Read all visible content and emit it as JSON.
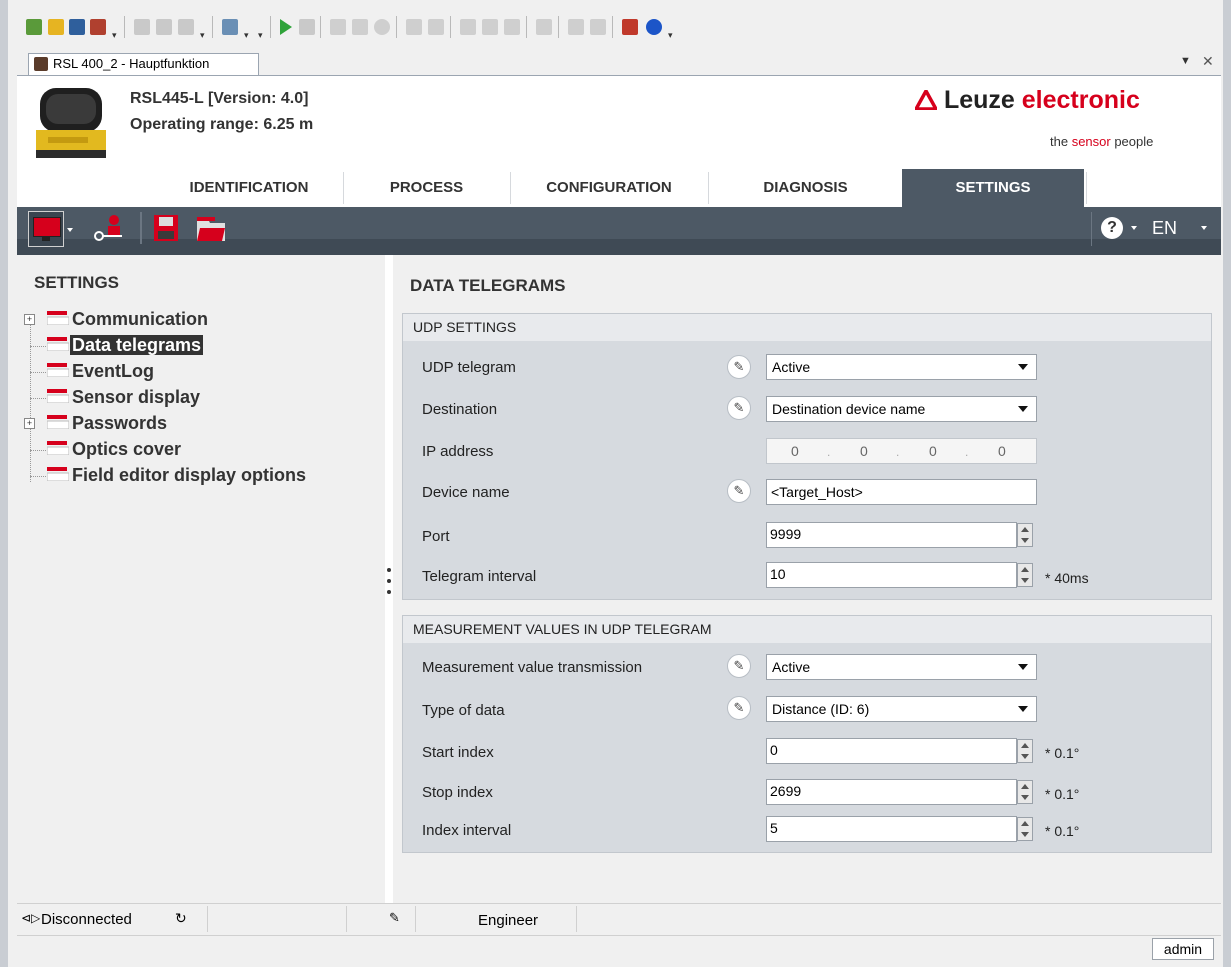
{
  "window": {
    "doc_tab_label": "RSL 400_2 - Hauptfunktion"
  },
  "header": {
    "device_name": "RSL445-L [Version: 4.0]",
    "operating_range": "Operating range: 6.25 m",
    "logo_brand": "Leuze",
    "logo_electronic": "electronic",
    "tagline_pre": "the ",
    "tagline_accent": "sensor",
    "tagline_post": " people",
    "brand_color": "#d6001c"
  },
  "tabs": [
    {
      "label": "IDENTIFICATION",
      "active": false
    },
    {
      "label": "PROCESS",
      "active": false
    },
    {
      "label": "CONFIGURATION",
      "active": false
    },
    {
      "label": "DIAGNOSIS",
      "active": false
    },
    {
      "label": "SETTINGS",
      "active": true
    }
  ],
  "toolstrip": {
    "help_icon": "question-circle-icon",
    "language": "EN"
  },
  "left": {
    "title": "SETTINGS",
    "items": [
      {
        "label": "Communication",
        "expandable": true
      },
      {
        "label": "Data telegrams",
        "selected": true
      },
      {
        "label": "EventLog"
      },
      {
        "label": "Sensor display"
      },
      {
        "label": "Passwords",
        "expandable": true
      },
      {
        "label": "Optics cover"
      },
      {
        "label": "Field editor display options"
      }
    ]
  },
  "main": {
    "title": "DATA TELEGRAMS",
    "udp": {
      "header": "UDP SETTINGS",
      "udp_telegram_label": "UDP telegram",
      "udp_telegram_value": "Active",
      "destination_label": "Destination",
      "destination_value": "Destination device name",
      "ip_label": "IP address",
      "ip_octets": [
        "0",
        "0",
        "0",
        "0"
      ],
      "device_name_label": "Device name",
      "device_name_value": "<Target_Host>",
      "port_label": "Port",
      "port_value": "9999",
      "interval_label": "Telegram interval",
      "interval_value": "10",
      "interval_unit": "* 40ms"
    },
    "meas": {
      "header": "MEASUREMENT VALUES IN UDP TELEGRAM",
      "transmission_label": "Measurement value transmission",
      "transmission_value": "Active",
      "type_label": "Type of data",
      "type_value": "Distance (ID: 6)",
      "start_label": "Start index",
      "start_value": "0",
      "start_unit": "* 0.1°",
      "stop_label": "Stop index",
      "stop_value": "2699",
      "stop_unit": "* 0.1°",
      "index_interval_label": "Index interval",
      "index_interval_value": "5",
      "index_interval_unit": "* 0.1°"
    }
  },
  "status": {
    "connection": "Disconnected",
    "role": "Engineer",
    "user": "admin"
  }
}
